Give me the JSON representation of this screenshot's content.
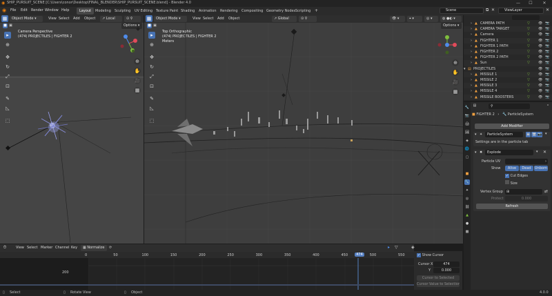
{
  "window": {
    "title": "SHIP_PURSUIT_SCENE [C:\\Users\\conor\\Desktop\\FINAL_BLENDER\\SHIP_PURSUIT_SCENE.blend] - Blender 4.0",
    "minimize": "—",
    "maximize": "☐",
    "close": "✕"
  },
  "menubar": {
    "items": [
      "File",
      "Edit",
      "Render",
      "Window",
      "Help"
    ],
    "workspaces": [
      "Layout",
      "Modeling",
      "Sculpting",
      "UV Editing",
      "Texture Paint",
      "Shading",
      "Animation",
      "Rendering",
      "Compositing",
      "Geometry Nodes",
      "Scripting"
    ],
    "active_workspace": "Layout",
    "scene": "Scene",
    "view_layer": "ViewLayer"
  },
  "viewport_left": {
    "mode": "Object Mode",
    "menus": [
      "View",
      "Select",
      "Add",
      "Object"
    ],
    "transform": "Local",
    "options": "Options",
    "info_title": "Camera Perspective",
    "info_sub": "(474) PROJECTILES | FIGHTER 2"
  },
  "viewport_right": {
    "mode": "Object Mode",
    "menus": [
      "View",
      "Select",
      "Add",
      "Object"
    ],
    "transform": "Global",
    "options": "Options",
    "info_title": "Top Orthographic",
    "info_sub": "(474) PROJECTILES | FIGHTER 2",
    "info_units": "Meters"
  },
  "outliner": {
    "search_placeholder": "",
    "rows": [
      {
        "name": "CAMERA PATH",
        "indent": 1
      },
      {
        "name": "CAMERA TARGET",
        "indent": 1
      },
      {
        "name": "Camera",
        "indent": 1
      },
      {
        "name": "FIGHTER 1",
        "indent": 1
      },
      {
        "name": "FIGHTER 1 PATH",
        "indent": 1
      },
      {
        "name": "FIGHTER 2",
        "indent": 1
      },
      {
        "name": "FIGHTER 2 PATH",
        "indent": 1
      },
      {
        "name": "Sun",
        "indent": 1
      },
      {
        "name": "PROJECTILES",
        "indent": 0
      },
      {
        "name": "MISSILE 1",
        "indent": 1
      },
      {
        "name": "MISSILE 2",
        "indent": 1
      },
      {
        "name": "MISSILE 3",
        "indent": 1
      },
      {
        "name": "MISSILE 4",
        "indent": 1
      },
      {
        "name": "MISSILE BOOSTERS",
        "indent": 1
      }
    ]
  },
  "properties": {
    "breadcrumb_object": "FIGHTER 2",
    "breadcrumb_system": "ParticleSystem",
    "add_modifier": "Add Modifier",
    "particle_modifier": "ParticleSystem",
    "settings_note": "Settings are in the particle tab",
    "explode_modifier": "Explode",
    "particle_uv_label": "Particle UV",
    "show_label": "Show",
    "show_alive": "Alive",
    "show_dead": "Dead",
    "show_unborn": "Unborn",
    "cut_edges": "Cut Edges",
    "size": "Size",
    "vertex_group_label": "Vertex Group",
    "protect_label": "Protect",
    "protect_value": "0.000",
    "refresh": "Refresh"
  },
  "timeline": {
    "menus": [
      "View",
      "Select",
      "Marker",
      "Channel",
      "Key"
    ],
    "normalize": "Normalize",
    "ticks": [
      "0",
      "50",
      "100",
      "150",
      "200",
      "250",
      "300",
      "350",
      "400",
      "450",
      "474",
      "500",
      "550"
    ],
    "current_frame": "474",
    "channel_value": "200",
    "show_cursor": "Show Cursor",
    "cursor_x_label": "Cursor X",
    "cursor_x_value": "474",
    "cursor_y_label": "Y",
    "cursor_y_value": "0.000",
    "cursor_to_selected": "Cursor to Selected",
    "cursor_value_to_selection": "Cursor Value to Selection"
  },
  "statusbar": {
    "left": "Select",
    "mid1": "Rotate View",
    "mid2": "Object",
    "version": "4.0.0"
  },
  "colors": {
    "accent": "#4772b3",
    "viewport_bg": "#3e3e3e",
    "panel_bg": "#2b2b2b",
    "playhead": "#5680c2"
  }
}
